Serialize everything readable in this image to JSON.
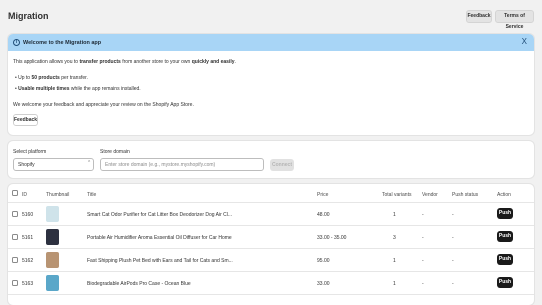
{
  "header": {
    "title": "Migration",
    "feedback_label": "Feedback",
    "terms_label": "Terms of Service"
  },
  "banner": {
    "title": "Welcome to the Migration app",
    "close": "X",
    "intro_prefix": "This application allows you to ",
    "intro_bold1": "transfer products",
    "intro_mid": " from another store to your own ",
    "intro_bold2": "quickly and easily",
    "intro_end": ".",
    "bullet1_prefix": "Up to ",
    "bullet1_bold": "50 products",
    "bullet1_suffix": " per transfer.",
    "bullet2_bold": "Usable multiple times",
    "bullet2_suffix": " while the app remains installed.",
    "feedback_text": "We welcome your feedback and appreciate your review on the Shopify App Store.",
    "feedback_button": "Feedback"
  },
  "form": {
    "platform_label": "Select platform",
    "platform_value": "Shopify",
    "domain_label": "Store domain",
    "domain_placeholder": "Enter store domain (e.g., mystore.myshopify.com)",
    "connect_label": "Connect"
  },
  "table": {
    "headers": {
      "id": "ID",
      "thumbnail": "Thumbnail",
      "title": "Title",
      "price": "Price",
      "variants": "Total variants",
      "vendor": "Vendor",
      "status": "Push status",
      "action": "Action"
    },
    "rows": [
      {
        "id": "5160",
        "title": "Smart Cat Odor Purifier for Cat Litter Box Deodorizer Dog Air Cl...",
        "price": "48.00",
        "variants": "1",
        "vendor": "-",
        "status": "-",
        "action": "Push",
        "thumb_color": "#cfe3ea"
      },
      {
        "id": "5161",
        "title": "Portable Air Humidifier Aroma Essential Oil Diffuser for Car Home",
        "price": "33.00 - 35.00",
        "variants": "3",
        "vendor": "-",
        "status": "-",
        "action": "Push",
        "thumb_color": "#2d3140"
      },
      {
        "id": "5162",
        "title": "Fast Shipping Plush Pet Bed with Ears and Tail for Cats and Sm...",
        "price": "95.00",
        "variants": "1",
        "vendor": "-",
        "status": "-",
        "action": "Push",
        "thumb_color": "#b89473"
      },
      {
        "id": "5163",
        "title": "Biodegradable AirPods Pro Case - Ocean Blue",
        "price": "33.00",
        "variants": "1",
        "vendor": "-",
        "status": "-",
        "action": "Push",
        "thumb_color": "#5aa7c9"
      }
    ]
  }
}
